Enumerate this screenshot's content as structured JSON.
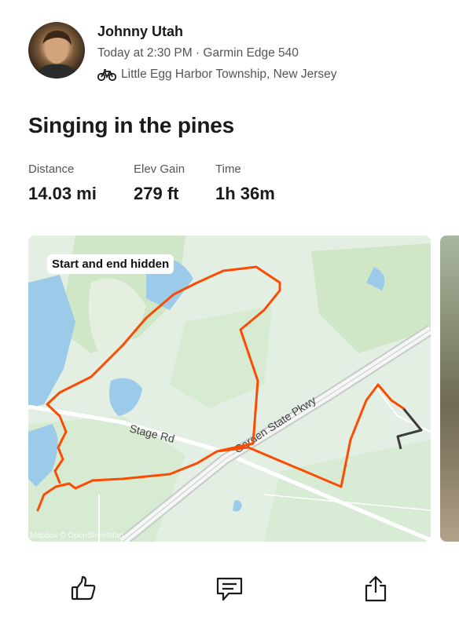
{
  "athlete": {
    "name": "Johnny Utah",
    "meta": "Today at 2:30 PM · Garmin Edge 540",
    "location": "Little Egg Harbor Township, New Jersey"
  },
  "activity": {
    "title": "Singing in the pines",
    "stats": [
      {
        "label": "Distance",
        "value": "14.03 mi"
      },
      {
        "label": "Elev Gain",
        "value": "279 ft"
      },
      {
        "label": "Time",
        "value": "1h 36m"
      }
    ]
  },
  "map": {
    "privacy_badge": "Start and end hidden",
    "road_labels": {
      "stage_rd": "Stage Rd",
      "parkway": "Garden State Pkwy"
    },
    "attribution": "Mapbox © OpenStreetMap",
    "route_color": "#fc4c02",
    "hidden_route_color": "#3d3d3d"
  },
  "icons": {
    "activity_type": "bike-icon",
    "kudos": "thumbs-up-icon",
    "comment": "comment-icon",
    "share": "share-icon"
  }
}
